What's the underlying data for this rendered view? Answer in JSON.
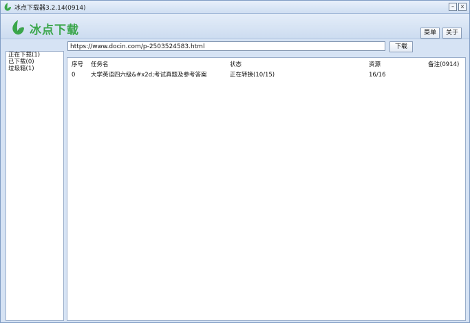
{
  "window": {
    "title": "冰点下载器3.2.14(0914)"
  },
  "header": {
    "logo_text": "冰点下载",
    "menu_label": "菜单",
    "about_label": "关于"
  },
  "sidebar": {
    "items": [
      {
        "label": "正在下载(1)"
      },
      {
        "label": "已下载(0)"
      },
      {
        "label": "垃圾箱(1)"
      }
    ]
  },
  "toolbar": {
    "url_value": "https://www.docin.com/p-2503524583.html",
    "download_label": "下载"
  },
  "table": {
    "columns": [
      "序号",
      "任务名",
      "状态",
      "资源",
      "备注(0914)"
    ],
    "rows": [
      [
        "0",
        "大学英语四六级&#x2d;考试真题及参考答案",
        "正在转换(10/15)",
        "16/16",
        ""
      ]
    ]
  },
  "colors": {
    "brand_green": "#3aa64a",
    "chrome_blue": "#d6e3f4"
  },
  "icons": {
    "app": "leaf-logo-icon",
    "minimize": "minimize-icon",
    "close": "close-icon"
  }
}
